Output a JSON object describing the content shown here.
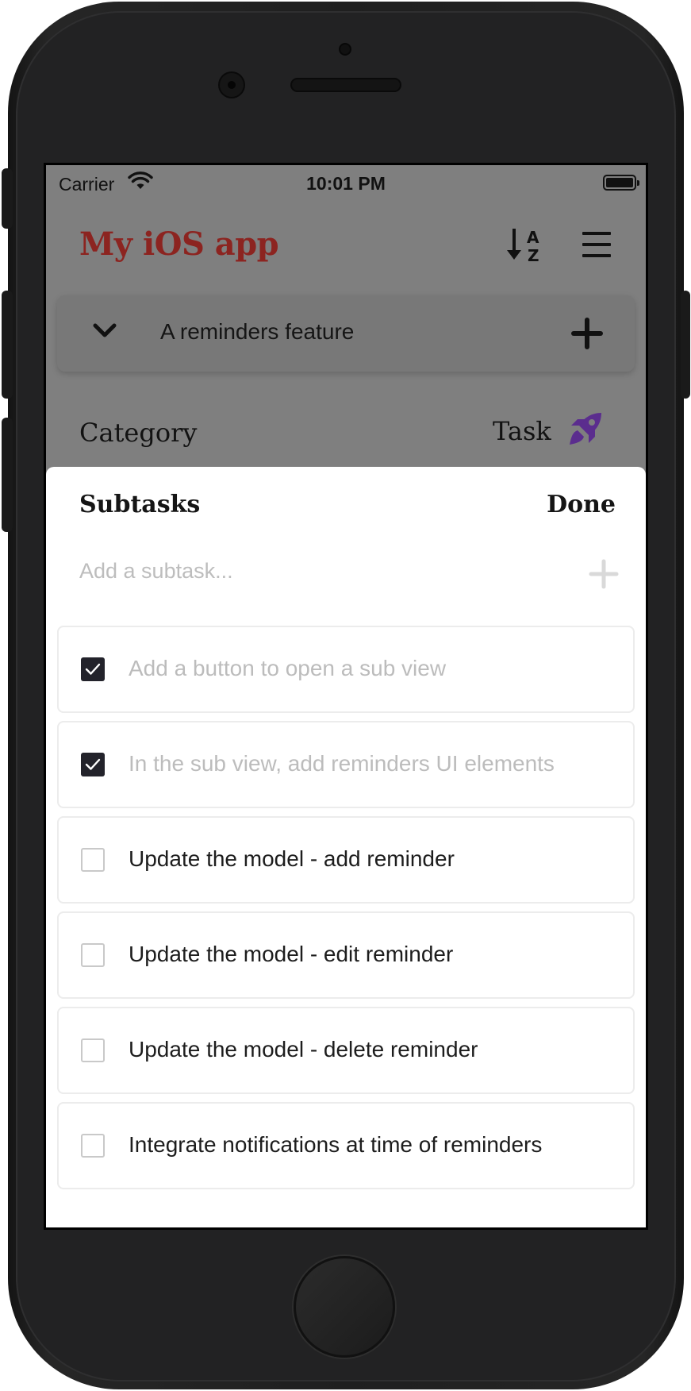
{
  "status_bar": {
    "carrier": "Carrier",
    "time": "10:01 PM"
  },
  "header": {
    "title": "My iOS app",
    "sort_icon": "sort-alpha-down-icon",
    "menu_icon": "hamburger-menu-icon"
  },
  "reminder_section": {
    "label": "A reminders feature",
    "collapse_icon": "chevron-down-icon",
    "add_icon": "plus-icon"
  },
  "category": {
    "label": "Category",
    "value": "Task",
    "icon": "rocket-icon",
    "icon_color": "#5b2d8e"
  },
  "colors": {
    "title_accent": "#8c2420",
    "overlay": "#7f7f7f",
    "checkbox_checked": "#23232b"
  },
  "subtasks_sheet": {
    "title": "Subtasks",
    "done_label": "Done",
    "input_placeholder": "Add a subtask...",
    "items": [
      {
        "text": "Add a button to open a sub view",
        "checked": true
      },
      {
        "text": "In the sub view, add reminders UI elements",
        "checked": true
      },
      {
        "text": "Update the model - add reminder",
        "checked": false
      },
      {
        "text": "Update the model - edit reminder",
        "checked": false
      },
      {
        "text": "Update the model - delete reminder",
        "checked": false
      },
      {
        "text": "Integrate notifications at time of reminders",
        "checked": false
      }
    ]
  }
}
